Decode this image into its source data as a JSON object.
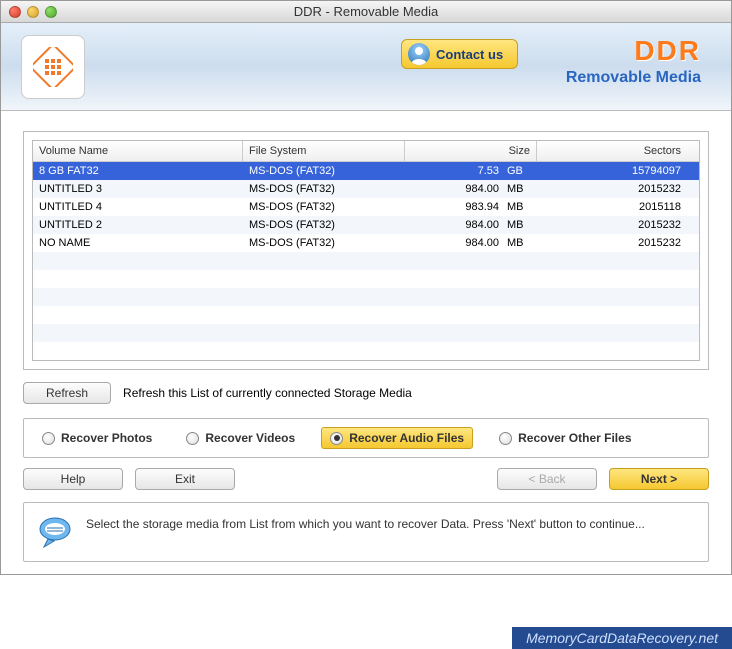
{
  "window": {
    "title": "DDR - Removable Media"
  },
  "banner": {
    "contact_label": "Contact us",
    "brand_title": "DDR",
    "brand_sub": "Removable Media"
  },
  "table": {
    "headers": {
      "volume": "Volume Name",
      "fs": "File System",
      "size": "Size",
      "sectors": "Sectors"
    },
    "rows": [
      {
        "volume": "8 GB FAT32",
        "fs": "MS-DOS (FAT32)",
        "size_num": "7.53",
        "size_unit": "GB",
        "sectors": "15794097",
        "selected": true
      },
      {
        "volume": "UNTITLED 3",
        "fs": "MS-DOS (FAT32)",
        "size_num": "984.00",
        "size_unit": "MB",
        "sectors": "2015232"
      },
      {
        "volume": "UNTITLED 4",
        "fs": "MS-DOS (FAT32)",
        "size_num": "983.94",
        "size_unit": "MB",
        "sectors": "2015118"
      },
      {
        "volume": "UNTITLED 2",
        "fs": "MS-DOS (FAT32)",
        "size_num": "984.00",
        "size_unit": "MB",
        "sectors": "2015232"
      },
      {
        "volume": "NO NAME",
        "fs": "MS-DOS (FAT32)",
        "size_num": "984.00",
        "size_unit": "MB",
        "sectors": "2015232"
      }
    ]
  },
  "refresh": {
    "button": "Refresh",
    "hint": "Refresh this List of currently connected Storage Media"
  },
  "recovery_options": {
    "photos": "Recover Photos",
    "videos": "Recover Videos",
    "audio": "Recover Audio Files",
    "other": "Recover Other Files",
    "selected": "audio"
  },
  "nav": {
    "help": "Help",
    "exit": "Exit",
    "back": "< Back",
    "next": "Next >"
  },
  "hint": {
    "text": "Select the storage media from List from which you want to recover Data. Press 'Next' button to continue..."
  },
  "watermark": "MemoryCardDataRecovery.net"
}
